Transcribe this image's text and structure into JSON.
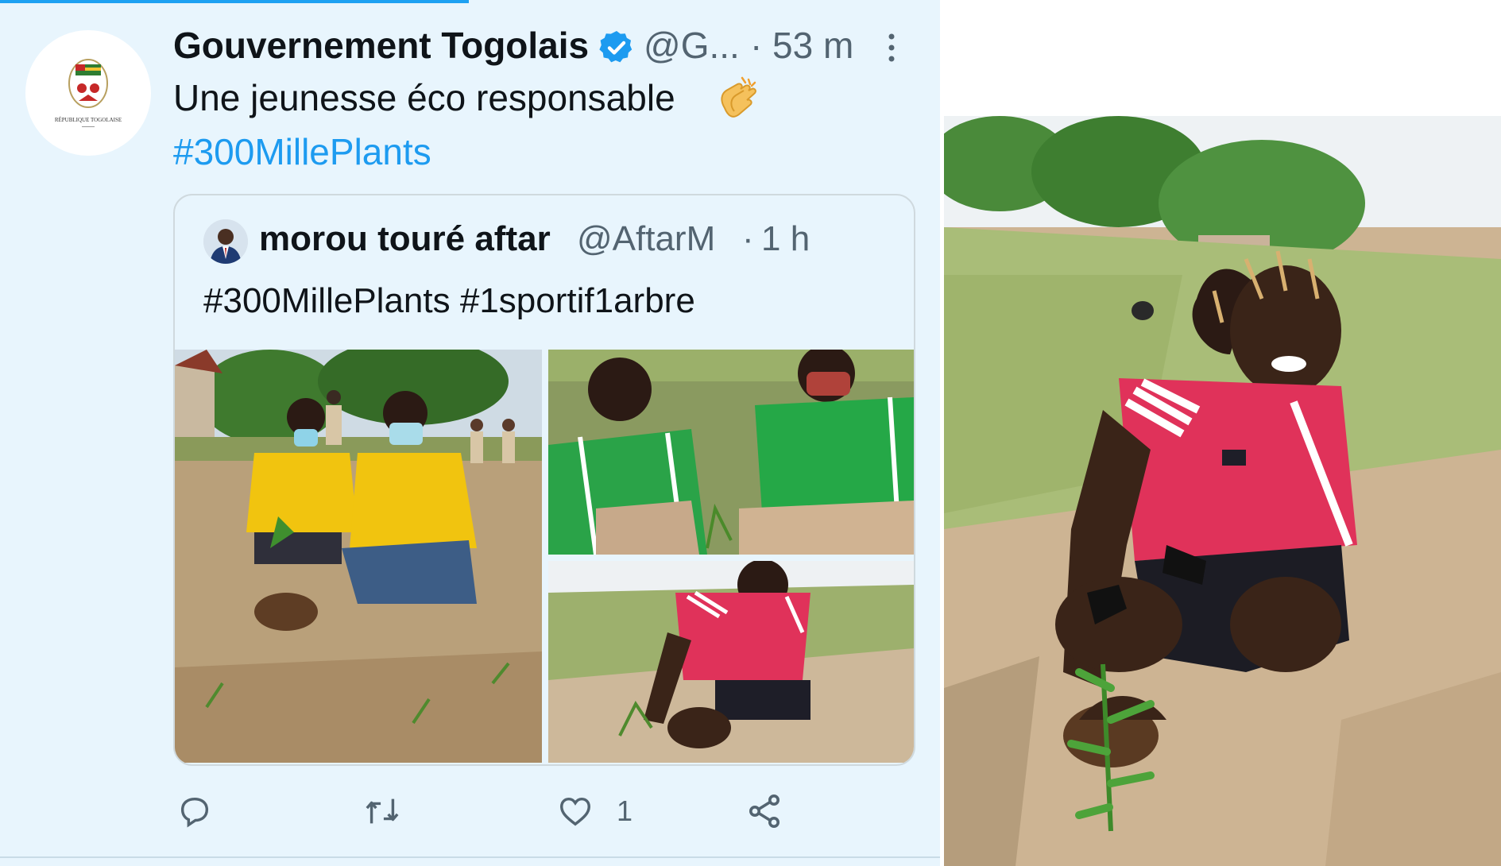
{
  "tweet": {
    "author_name": "Gouvernement Togolais",
    "verified_icon": "verified-badge-icon",
    "handle": "@G...",
    "separator": "·",
    "time": "53 m",
    "text": "Une jeunesse éco responsable",
    "emoji_icon": "clapping-hands-icon",
    "hashtag": "#300MillePlants",
    "avatar_caption": "RÉPUBLIQUE TOGOLAISE"
  },
  "quoted_tweet": {
    "author_name": "morou touré aftar",
    "handle": "@AftarM",
    "separator": "·",
    "time": "1 h",
    "text": "#300MillePlants #1sportif1arbre",
    "photos": [
      "boys-planting-tree-photo",
      "boys-in-green-jerseys-photo",
      "girl-planting-tree-photo"
    ]
  },
  "actions": {
    "reply_icon": "reply-icon",
    "retweet_icon": "retweet-icon",
    "like_icon": "like-icon",
    "like_count": "1",
    "share_icon": "share-icon"
  },
  "colors": {
    "background": "#e8f5fd",
    "link": "#1d9bf0",
    "text_primary": "#0f1419",
    "text_secondary": "#536471",
    "verified": "#1d9bf0"
  }
}
